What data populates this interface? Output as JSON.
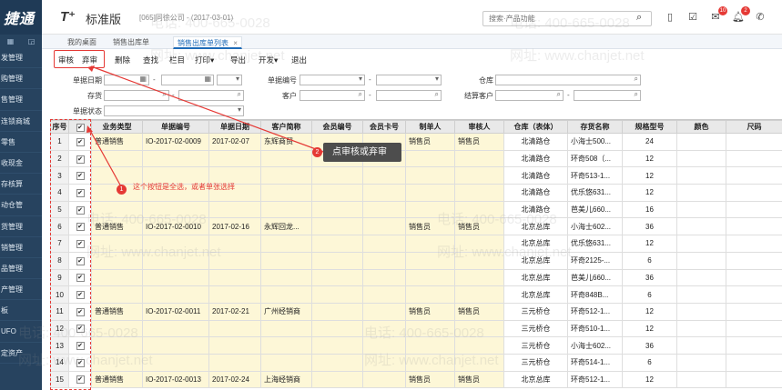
{
  "brand": "捷通",
  "product": {
    "logo": "T⁺",
    "name": "标准版",
    "company": "[065]同徐公司 - (2017-03-01)"
  },
  "search": {
    "placeholder": "搜索·产品功能"
  },
  "notifications": {
    "messages": "10",
    "alerts": "2"
  },
  "nav": [
    "发管理",
    "购管理",
    "售管理",
    "连锁商城",
    "零售",
    "收现金",
    "存核算",
    "动仓管",
    "货管理",
    "销管理",
    "品管理",
    "产管理",
    "板",
    "UFO",
    "定资产"
  ],
  "tabs": [
    {
      "label": "我的桌面"
    },
    {
      "label": "销售出库单"
    },
    {
      "label": "销售出库单列表",
      "close": "×"
    }
  ],
  "toolbar": [
    "审核",
    "弃审",
    "删除",
    "查找",
    "栏目",
    "打印▾",
    "导出",
    "开发▾",
    "退出"
  ],
  "filter": {
    "date": "单据日期",
    "code": "单据编号",
    "warehouse": "仓库",
    "inventory": "存货",
    "customer": "客户",
    "settle_customer": "结算客户",
    "status": "单据状态",
    "dash": "-"
  },
  "table": {
    "headers": [
      "序号",
      "✔",
      "业务类型",
      "单据编号",
      "单据日期",
      "客户简称",
      "会员编号",
      "会员卡号",
      "制单人",
      "审核人",
      "仓库（表体）",
      "存货名称",
      "规格型号",
      "颜色",
      "尺码"
    ],
    "rows": [
      {
        "no": "1",
        "type": "普通销售",
        "code": "IO-2017-02-0009",
        "date": "2017-02-07",
        "customer": "东辉商贸",
        "maker": "销售员",
        "auditor": "销售员",
        "wh": "北清路仓",
        "item": "小海士500...",
        "qty": "24"
      },
      {
        "no": "2",
        "type": "",
        "code": "",
        "date": "",
        "customer": "",
        "maker": "",
        "auditor": "",
        "wh": "北清路仓",
        "item": "环奇508（...",
        "qty": "12"
      },
      {
        "no": "3",
        "type": "",
        "code": "",
        "date": "",
        "customer": "",
        "maker": "",
        "auditor": "",
        "wh": "北清路仓",
        "item": "环奇513-1...",
        "qty": "12"
      },
      {
        "no": "4",
        "type": "",
        "code": "",
        "date": "",
        "customer": "",
        "maker": "",
        "auditor": "",
        "wh": "北清路仓",
        "item": "优乐悠631...",
        "qty": "12"
      },
      {
        "no": "5",
        "type": "",
        "code": "",
        "date": "",
        "customer": "",
        "maker": "",
        "auditor": "",
        "wh": "北清路仓",
        "item": "芭美儿660...",
        "qty": "16"
      },
      {
        "no": "6",
        "type": "普通销售",
        "code": "IO-2017-02-0010",
        "date": "2017-02-16",
        "customer": "永辉回龙...",
        "maker": "销售员",
        "auditor": "销售员",
        "wh": "北京总库",
        "item": "小海士602...",
        "qty": "36"
      },
      {
        "no": "7",
        "type": "",
        "code": "",
        "date": "",
        "customer": "",
        "maker": "",
        "auditor": "",
        "wh": "北京总库",
        "item": "优乐悠631...",
        "qty": "12"
      },
      {
        "no": "8",
        "type": "",
        "code": "",
        "date": "",
        "customer": "",
        "maker": "",
        "auditor": "",
        "wh": "北京总库",
        "item": "环奇2125-...",
        "qty": "6"
      },
      {
        "no": "9",
        "type": "",
        "code": "",
        "date": "",
        "customer": "",
        "maker": "",
        "auditor": "",
        "wh": "北京总库",
        "item": "芭美儿660...",
        "qty": "36"
      },
      {
        "no": "10",
        "type": "",
        "code": "",
        "date": "",
        "customer": "",
        "maker": "",
        "auditor": "",
        "wh": "北京总库",
        "item": "环奇848B...",
        "qty": "6"
      },
      {
        "no": "11",
        "type": "普通销售",
        "code": "IO-2017-02-0011",
        "date": "2017-02-21",
        "customer": "广州经销商",
        "maker": "销售员",
        "auditor": "销售员",
        "wh": "三元桥仓",
        "item": "环奇512-1...",
        "qty": "12"
      },
      {
        "no": "12",
        "type": "",
        "code": "",
        "date": "",
        "customer": "",
        "maker": "",
        "auditor": "",
        "wh": "三元桥仓",
        "item": "环奇510-1...",
        "qty": "12"
      },
      {
        "no": "13",
        "type": "",
        "code": "",
        "date": "",
        "customer": "",
        "maker": "",
        "auditor": "",
        "wh": "三元桥仓",
        "item": "小海士602...",
        "qty": "36"
      },
      {
        "no": "14",
        "type": "",
        "code": "",
        "date": "",
        "customer": "",
        "maker": "",
        "auditor": "",
        "wh": "三元桥仓",
        "item": "环奇514-1...",
        "qty": "6"
      },
      {
        "no": "15",
        "type": "普通销售",
        "code": "IO-2017-02-0013",
        "date": "2017-02-24",
        "customer": "上海经销商",
        "maker": "销售员",
        "auditor": "销售员",
        "wh": "北京总库",
        "item": "环奇512-1...",
        "qty": "12"
      }
    ]
  },
  "annotations": {
    "num1": "1",
    "text1": "这个按钮是全选，或者单张选择",
    "num2": "2",
    "text2": "点审核或弃审"
  },
  "watermark": {
    "phone": "电话: 400-665-0028",
    "site": "网址: www.chanjet.net"
  },
  "colors": {
    "nav": "#27435f",
    "accent": "#1e6bb8",
    "annotation": "#e53935",
    "row_highlight": "#fdf7d7"
  }
}
